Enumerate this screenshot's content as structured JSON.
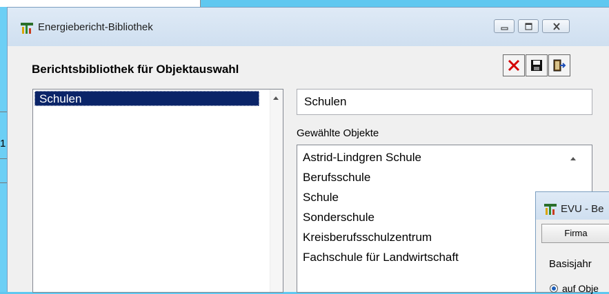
{
  "window": {
    "title": "Energiebericht-Bibliothek",
    "heading": "Berichtsbibliothek für Objektauswahl"
  },
  "toolbar": {
    "delete_icon": "delete-icon",
    "save_icon": "save-icon",
    "exit_icon": "exit-icon"
  },
  "library": {
    "items": [
      "Schulen"
    ],
    "selected": "Schulen"
  },
  "report_name": {
    "value": "Schulen"
  },
  "objects": {
    "label": "Gewählte Objekte",
    "items": [
      "Astrid-Lindgren Schule",
      "Berufsschule",
      "Schule",
      "Sonderschule",
      "Kreisberufsschulzentrum",
      "Fachschule für Landwirtschaft"
    ]
  },
  "second_window": {
    "title": "EVU - Be",
    "tab_label": "Firma",
    "basisjahr_label": "Basisjahr",
    "radio_label": "auf Obje"
  },
  "background": {
    "fragment": "1"
  },
  "colors": {
    "selection": "#0a2468",
    "delete_red": "#d40000"
  }
}
